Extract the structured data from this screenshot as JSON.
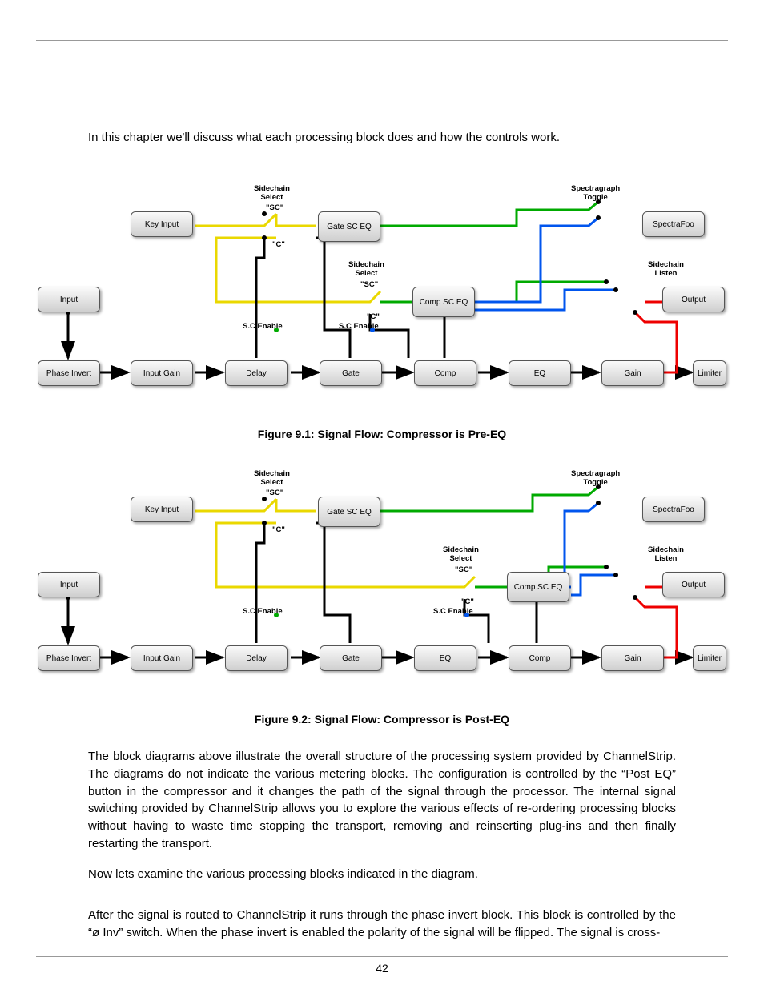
{
  "intro": "In this chapter we'll discuss what each processing block does and how the controls work.",
  "figure1": {
    "caption": "Figure 9.1: Signal Flow: Compressor is Pre-EQ",
    "labels": {
      "sc_select1": "Sidechain\nSelect",
      "sc": "\"SC\"",
      "c": "\"C\"",
      "sc_select2": "Sidechain\nSelect",
      "spectra_toggle": "Spectragraph\nToggle",
      "sc_listen": "Sidechain\nListen",
      "sc_enable": "S.C Enable"
    },
    "nodes": {
      "key": "Key Input",
      "gateeq": "Gate\nSC EQ",
      "compeq": "Comp\nSC EQ",
      "spectra": "SpectraFoo",
      "input": "Input",
      "output": "Output",
      "phase": "Phase Invert",
      "inputgain": "Input Gain",
      "delay": "Delay",
      "gate": "Gate",
      "comp": "Comp",
      "eq": "EQ",
      "gain": "Gain",
      "limiter": "Limiter"
    }
  },
  "figure2": {
    "caption": "Figure 9.2: Signal Flow: Compressor is Post-EQ",
    "labels": {
      "sc_select1": "Sidechain\nSelect",
      "sc": "\"SC\"",
      "c": "\"C\"",
      "sc_select2": "Sidechain\nSelect",
      "spectra_toggle": "Spectragraph\nToggle",
      "sc_listen": "Sidechain\nListen",
      "sc_enable": "S.C Enable"
    },
    "nodes": {
      "key": "Key Input",
      "gateeq": "Gate\nSC EQ",
      "compeq": "Comp\nSC EQ",
      "spectra": "SpectraFoo",
      "input": "Input",
      "output": "Output",
      "phase": "Phase Invert",
      "inputgain": "Input Gain",
      "delay": "Delay",
      "gate": "Gate",
      "eq": "EQ",
      "comp": "Comp",
      "gain": "Gain",
      "limiter": "Limiter"
    }
  },
  "para1": "The block diagrams above illustrate the overall structure of the processing system provided by ChannelStrip. The diagrams do not indicate the various metering blocks. The configuration is controlled by the “Post EQ” button in the compressor and it changes the path of the signal through the processor. The internal signal switching provided by ChannelStrip allows you to explore the various effects of re-ordering processing blocks without having to waste time stopping the transport, removing and reinserting plug-ins and then finally restarting the transport.",
  "para2": "Now lets examine the various processing blocks indicated in the diagram.",
  "para3": "After the signal is routed to ChannelStrip it runs through the phase invert block. This block is controlled by the “ø Inv” switch. When the phase invert is enabled the polarity of the signal will be flipped. The signal is cross-",
  "pagenum": "42",
  "wire_colors": {
    "main": "#000",
    "key": "#ead800",
    "sc1": "#0a0",
    "sc2": "#05e",
    "listen": "#e00"
  }
}
